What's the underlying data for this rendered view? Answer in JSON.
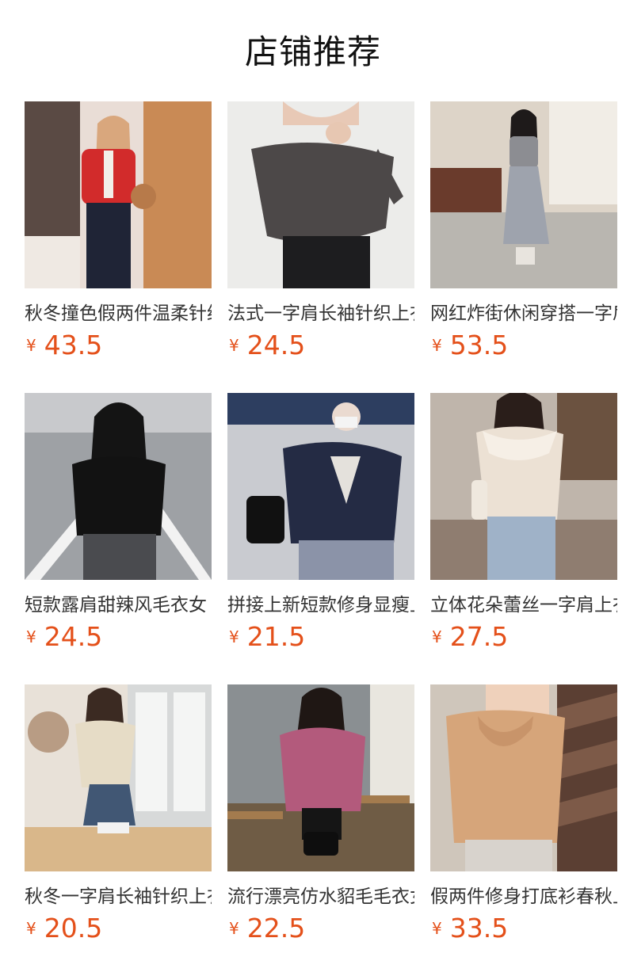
{
  "section_title": "店铺推荐",
  "products": [
    {
      "name": "秋冬撞色假两件温柔针织开衫",
      "currency": "¥",
      "price": "43.5"
    },
    {
      "name": "法式一字肩长袖针织上衣",
      "currency": "¥",
      "price": "24.5"
    },
    {
      "name": "网红炸街休闲穿搭一字肩上衣",
      "currency": "¥",
      "price": "53.5"
    },
    {
      "name": "短款露肩甜辣风毛衣女",
      "currency": "¥",
      "price": "24.5"
    },
    {
      "name": "拼接上新短款修身显瘦上衣",
      "currency": "¥",
      "price": "21.5"
    },
    {
      "name": "立体花朵蕾丝一字肩上衣",
      "currency": "¥",
      "price": "27.5"
    },
    {
      "name": "秋冬一字肩长袖针织上衣",
      "currency": "¥",
      "price": "20.5"
    },
    {
      "name": "流行漂亮仿水貂毛毛衣女",
      "currency": "¥",
      "price": "22.5"
    },
    {
      "name": "假两件修身打底衫春秋上衣",
      "currency": "¥",
      "price": "33.5"
    }
  ]
}
